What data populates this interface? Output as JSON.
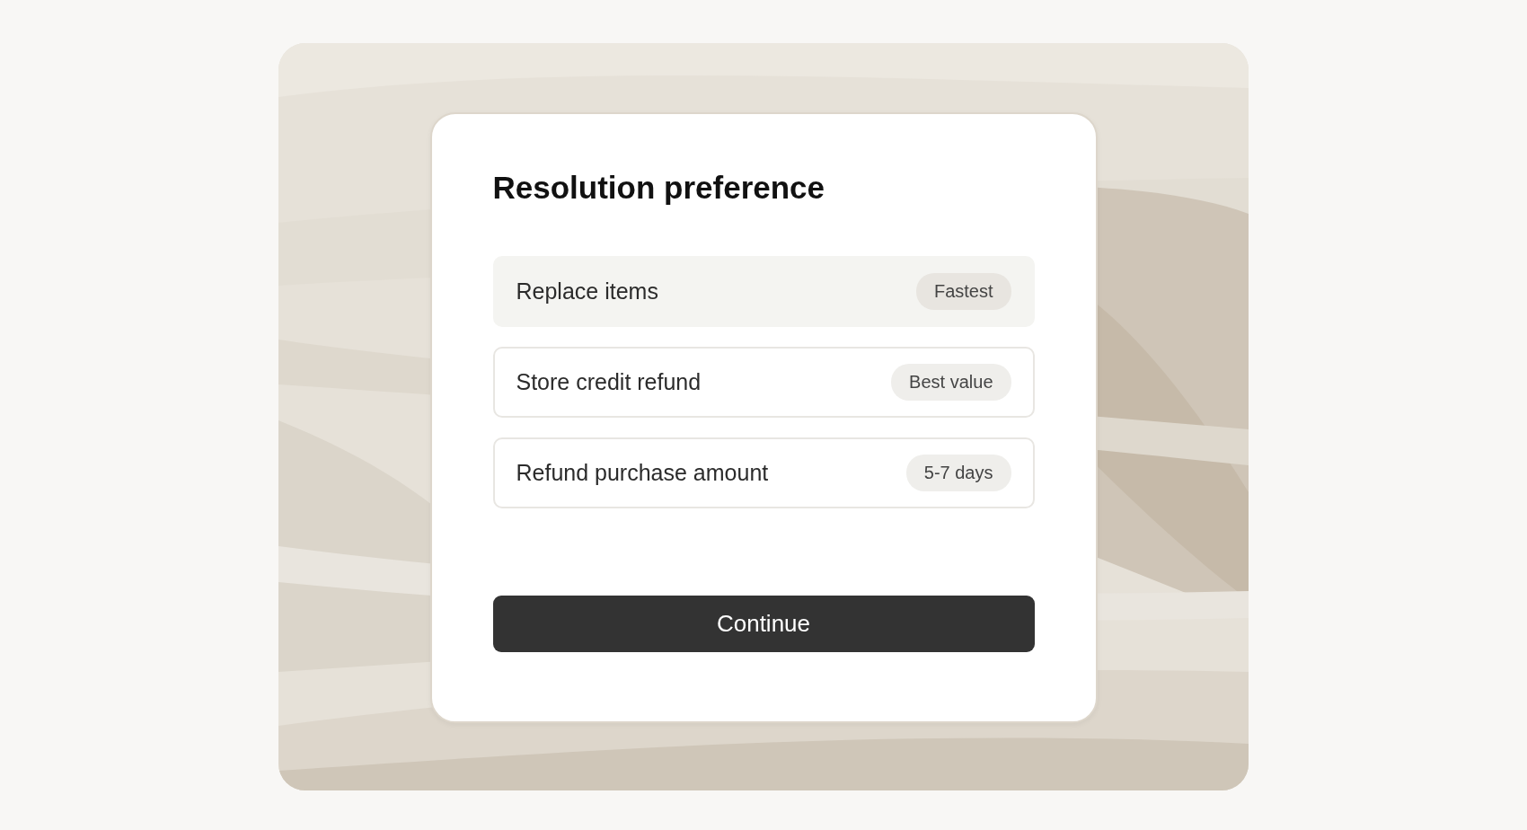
{
  "dialog": {
    "title": "Resolution preference",
    "options": [
      {
        "label": "Replace items",
        "badge": "Fastest",
        "selected": true
      },
      {
        "label": "Store credit refund",
        "badge": "Best value",
        "selected": false
      },
      {
        "label": "Refund purchase amount",
        "badge": "5-7 days",
        "selected": false
      }
    ],
    "button": "Continue"
  }
}
